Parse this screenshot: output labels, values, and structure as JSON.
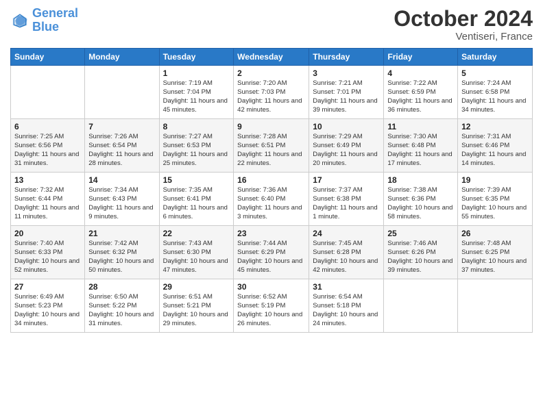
{
  "header": {
    "logo_line1": "General",
    "logo_line2": "Blue",
    "month": "October 2024",
    "location": "Ventiseri, France"
  },
  "days_of_week": [
    "Sunday",
    "Monday",
    "Tuesday",
    "Wednesday",
    "Thursday",
    "Friday",
    "Saturday"
  ],
  "weeks": [
    [
      {
        "day": "",
        "detail": ""
      },
      {
        "day": "",
        "detail": ""
      },
      {
        "day": "1",
        "detail": "Sunrise: 7:19 AM\nSunset: 7:04 PM\nDaylight: 11 hours and 45 minutes."
      },
      {
        "day": "2",
        "detail": "Sunrise: 7:20 AM\nSunset: 7:03 PM\nDaylight: 11 hours and 42 minutes."
      },
      {
        "day": "3",
        "detail": "Sunrise: 7:21 AM\nSunset: 7:01 PM\nDaylight: 11 hours and 39 minutes."
      },
      {
        "day": "4",
        "detail": "Sunrise: 7:22 AM\nSunset: 6:59 PM\nDaylight: 11 hours and 36 minutes."
      },
      {
        "day": "5",
        "detail": "Sunrise: 7:24 AM\nSunset: 6:58 PM\nDaylight: 11 hours and 34 minutes."
      }
    ],
    [
      {
        "day": "6",
        "detail": "Sunrise: 7:25 AM\nSunset: 6:56 PM\nDaylight: 11 hours and 31 minutes."
      },
      {
        "day": "7",
        "detail": "Sunrise: 7:26 AM\nSunset: 6:54 PM\nDaylight: 11 hours and 28 minutes."
      },
      {
        "day": "8",
        "detail": "Sunrise: 7:27 AM\nSunset: 6:53 PM\nDaylight: 11 hours and 25 minutes."
      },
      {
        "day": "9",
        "detail": "Sunrise: 7:28 AM\nSunset: 6:51 PM\nDaylight: 11 hours and 22 minutes."
      },
      {
        "day": "10",
        "detail": "Sunrise: 7:29 AM\nSunset: 6:49 PM\nDaylight: 11 hours and 20 minutes."
      },
      {
        "day": "11",
        "detail": "Sunrise: 7:30 AM\nSunset: 6:48 PM\nDaylight: 11 hours and 17 minutes."
      },
      {
        "day": "12",
        "detail": "Sunrise: 7:31 AM\nSunset: 6:46 PM\nDaylight: 11 hours and 14 minutes."
      }
    ],
    [
      {
        "day": "13",
        "detail": "Sunrise: 7:32 AM\nSunset: 6:44 PM\nDaylight: 11 hours and 11 minutes."
      },
      {
        "day": "14",
        "detail": "Sunrise: 7:34 AM\nSunset: 6:43 PM\nDaylight: 11 hours and 9 minutes."
      },
      {
        "day": "15",
        "detail": "Sunrise: 7:35 AM\nSunset: 6:41 PM\nDaylight: 11 hours and 6 minutes."
      },
      {
        "day": "16",
        "detail": "Sunrise: 7:36 AM\nSunset: 6:40 PM\nDaylight: 11 hours and 3 minutes."
      },
      {
        "day": "17",
        "detail": "Sunrise: 7:37 AM\nSunset: 6:38 PM\nDaylight: 11 hours and 1 minute."
      },
      {
        "day": "18",
        "detail": "Sunrise: 7:38 AM\nSunset: 6:36 PM\nDaylight: 10 hours and 58 minutes."
      },
      {
        "day": "19",
        "detail": "Sunrise: 7:39 AM\nSunset: 6:35 PM\nDaylight: 10 hours and 55 minutes."
      }
    ],
    [
      {
        "day": "20",
        "detail": "Sunrise: 7:40 AM\nSunset: 6:33 PM\nDaylight: 10 hours and 52 minutes."
      },
      {
        "day": "21",
        "detail": "Sunrise: 7:42 AM\nSunset: 6:32 PM\nDaylight: 10 hours and 50 minutes."
      },
      {
        "day": "22",
        "detail": "Sunrise: 7:43 AM\nSunset: 6:30 PM\nDaylight: 10 hours and 47 minutes."
      },
      {
        "day": "23",
        "detail": "Sunrise: 7:44 AM\nSunset: 6:29 PM\nDaylight: 10 hours and 45 minutes."
      },
      {
        "day": "24",
        "detail": "Sunrise: 7:45 AM\nSunset: 6:28 PM\nDaylight: 10 hours and 42 minutes."
      },
      {
        "day": "25",
        "detail": "Sunrise: 7:46 AM\nSunset: 6:26 PM\nDaylight: 10 hours and 39 minutes."
      },
      {
        "day": "26",
        "detail": "Sunrise: 7:48 AM\nSunset: 6:25 PM\nDaylight: 10 hours and 37 minutes."
      }
    ],
    [
      {
        "day": "27",
        "detail": "Sunrise: 6:49 AM\nSunset: 5:23 PM\nDaylight: 10 hours and 34 minutes."
      },
      {
        "day": "28",
        "detail": "Sunrise: 6:50 AM\nSunset: 5:22 PM\nDaylight: 10 hours and 31 minutes."
      },
      {
        "day": "29",
        "detail": "Sunrise: 6:51 AM\nSunset: 5:21 PM\nDaylight: 10 hours and 29 minutes."
      },
      {
        "day": "30",
        "detail": "Sunrise: 6:52 AM\nSunset: 5:19 PM\nDaylight: 10 hours and 26 minutes."
      },
      {
        "day": "31",
        "detail": "Sunrise: 6:54 AM\nSunset: 5:18 PM\nDaylight: 10 hours and 24 minutes."
      },
      {
        "day": "",
        "detail": ""
      },
      {
        "day": "",
        "detail": ""
      }
    ]
  ]
}
